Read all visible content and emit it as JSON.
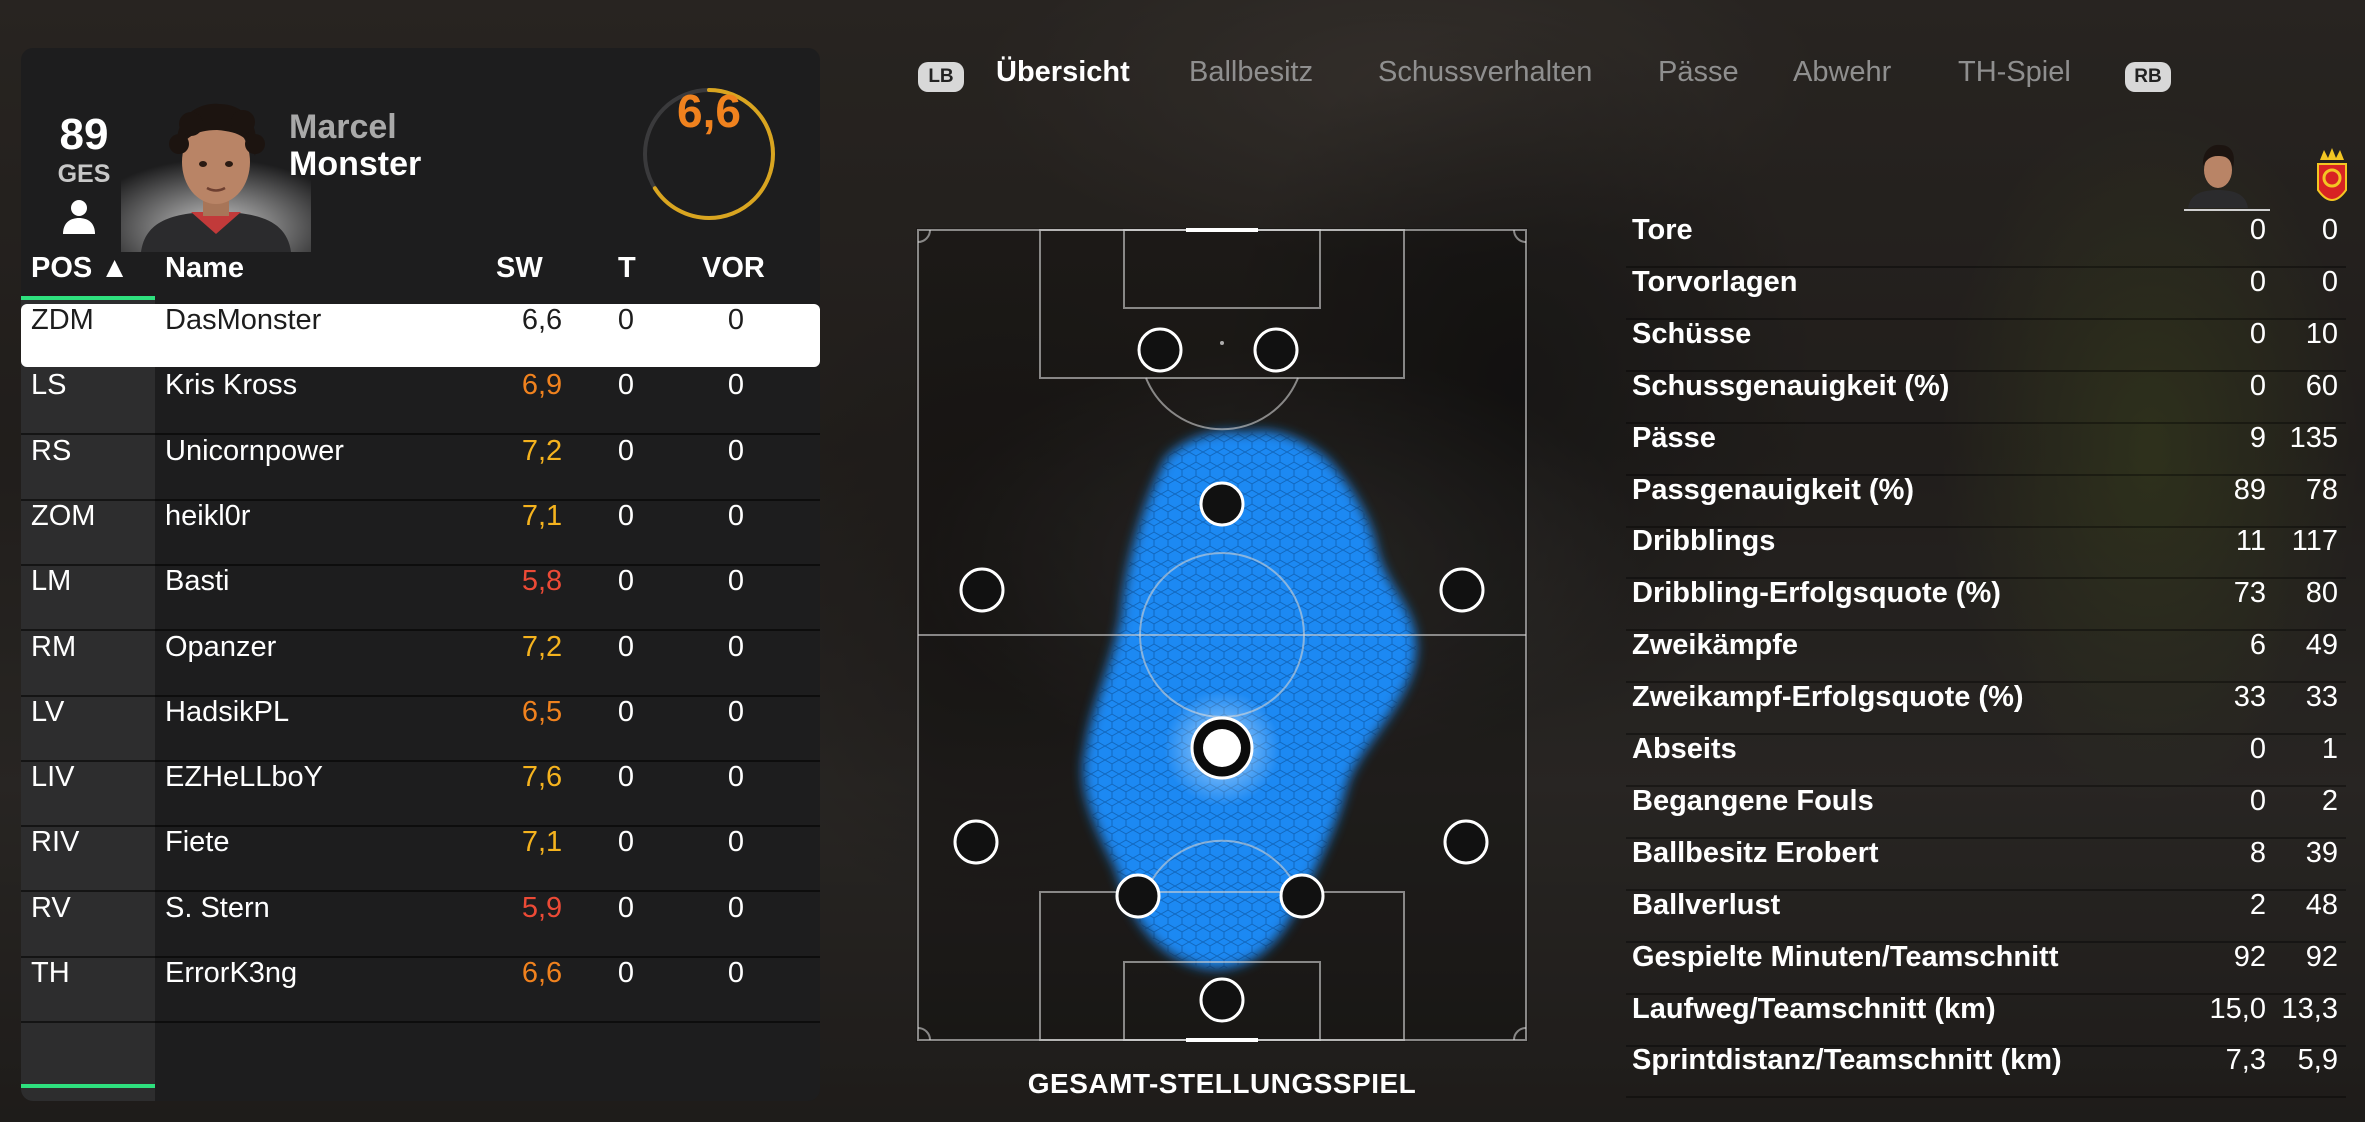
{
  "player": {
    "overall": "89",
    "overall_label": "GES",
    "first_name": "Marcel",
    "last_name": "Monster",
    "match_rating": "6,6",
    "match_rating_fraction": 0.66
  },
  "table": {
    "headers": {
      "pos": "POS ▲",
      "name": "Name",
      "rating": "SW",
      "goals": "T",
      "assists": "VOR"
    },
    "rows": [
      {
        "pos": "ZDM",
        "name": "DasMonster",
        "rating": "6,6",
        "goals": "0",
        "assists": "0",
        "color": "#1d1d1d"
      },
      {
        "pos": "LS",
        "name": "Kris Kross",
        "rating": "6,9",
        "goals": "0",
        "assists": "0",
        "color": "#f0821e"
      },
      {
        "pos": "RS",
        "name": "Unicornpower",
        "rating": "7,2",
        "goals": "0",
        "assists": "0",
        "color": "#f5b31e"
      },
      {
        "pos": "ZOM",
        "name": "heikl0r",
        "rating": "7,1",
        "goals": "0",
        "assists": "0",
        "color": "#f5b31e"
      },
      {
        "pos": "LM",
        "name": "Basti",
        "rating": "5,8",
        "goals": "0",
        "assists": "0",
        "color": "#ec4a36"
      },
      {
        "pos": "RM",
        "name": "Opanzer",
        "rating": "7,2",
        "goals": "0",
        "assists": "0",
        "color": "#f5b31e"
      },
      {
        "pos": "LV",
        "name": "HadsikPL",
        "rating": "6,5",
        "goals": "0",
        "assists": "0",
        "color": "#f0821e"
      },
      {
        "pos": "LIV",
        "name": "EZHeLLboY",
        "rating": "7,6",
        "goals": "0",
        "assists": "0",
        "color": "#f5b31e"
      },
      {
        "pos": "RIV",
        "name": "Fiete",
        "rating": "7,1",
        "goals": "0",
        "assists": "0",
        "color": "#f5b31e"
      },
      {
        "pos": "RV",
        "name": "S. Stern",
        "rating": "5,9",
        "goals": "0",
        "assists": "0",
        "color": "#ec4a36"
      },
      {
        "pos": "TH",
        "name": "ErrorK3ng",
        "rating": "6,6",
        "goals": "0",
        "assists": "0",
        "color": "#f0821e"
      }
    ]
  },
  "tabs": {
    "left_button": "LB",
    "right_button": "RB",
    "items": [
      "Übersicht",
      "Ballbesitz",
      "Schussverhalten",
      "Pässe",
      "Abwehr",
      "TH-Spiel"
    ],
    "active": "Übersicht"
  },
  "pitch": {
    "caption": "GESAMT-STELLUNGSSPIEL",
    "heatmap_color": "#1a8fff"
  },
  "stats": [
    {
      "label": "Tore",
      "player": "0",
      "team": "0"
    },
    {
      "label": "Torvorlagen",
      "player": "0",
      "team": "0"
    },
    {
      "label": "Schüsse",
      "player": "0",
      "team": "10"
    },
    {
      "label": "Schussgenauigkeit (%)",
      "player": "0",
      "team": "60"
    },
    {
      "label": "Pässe",
      "player": "9",
      "team": "135"
    },
    {
      "label": "Passgenauigkeit (%)",
      "player": "89",
      "team": "78"
    },
    {
      "label": "Dribblings",
      "player": "11",
      "team": "117"
    },
    {
      "label": "Dribbling-Erfolgsquote (%)",
      "player": "73",
      "team": "80"
    },
    {
      "label": "Zweikämpfe",
      "player": "6",
      "team": "49"
    },
    {
      "label": "Zweikampf-Erfolgsquote (%)",
      "player": "33",
      "team": "33"
    },
    {
      "label": "Abseits",
      "player": "0",
      "team": "1"
    },
    {
      "label": "Begangene Fouls",
      "player": "0",
      "team": "2"
    },
    {
      "label": "Ballbesitz Erobert",
      "player": "8",
      "team": "39"
    },
    {
      "label": "Ballverlust",
      "player": "2",
      "team": "48"
    },
    {
      "label": "Gespielte Minuten/Teamschnitt",
      "player": "92",
      "team": "92"
    },
    {
      "label": "Laufweg/Teamschnitt (km)",
      "player": "15,0",
      "team": "13,3"
    },
    {
      "label": "Sprintdistanz/Teamschnitt (km)",
      "player": "7,3",
      "team": "5,9"
    }
  ],
  "colors": {
    "accent_green": "#2ee07e",
    "rating_orange": "#f0821e",
    "rating_yellow": "#f5b31e",
    "rating_red": "#ec4a36",
    "ring_gold": "#d9a520"
  }
}
